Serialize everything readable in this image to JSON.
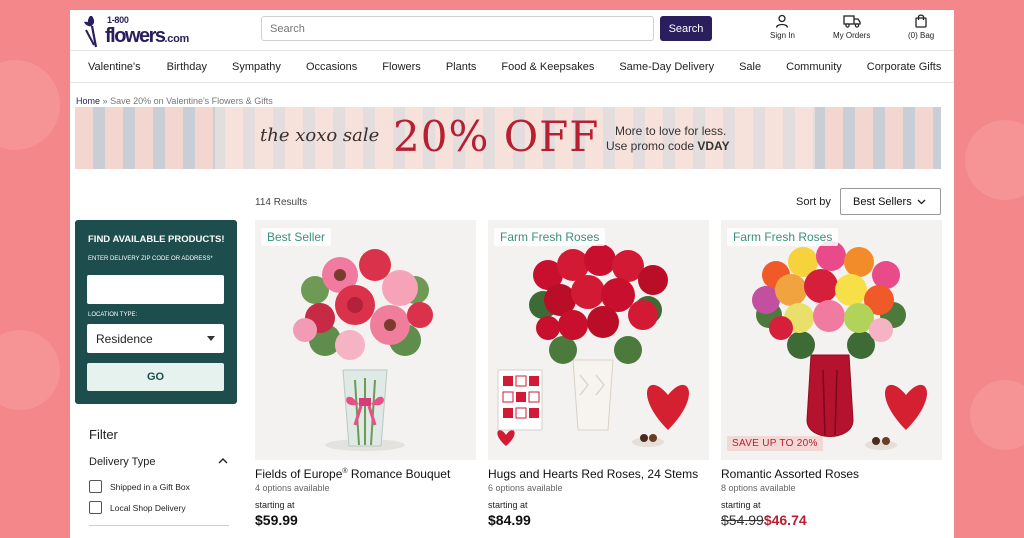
{
  "brand": {
    "logo_top": "1-800",
    "logo_main": "flowers",
    "logo_suffix": ".com"
  },
  "search": {
    "placeholder": "Search",
    "button_label": "Search"
  },
  "header_actions": [
    {
      "label": "Sign In",
      "icon": "user-icon"
    },
    {
      "label": "My Orders",
      "icon": "truck-icon"
    },
    {
      "label": "(0) Bag",
      "icon": "bag-icon"
    }
  ],
  "nav": [
    "Valentine's",
    "Birthday",
    "Sympathy",
    "Occasions",
    "Flowers",
    "Plants",
    "Food & Keepsakes",
    "Same-Day Delivery",
    "Sale",
    "Community",
    "Corporate Gifts"
  ],
  "breadcrumb": {
    "home": "Home",
    "separator": "»",
    "current": "Save 20% on Valentine's Flowers & Gifts"
  },
  "banner": {
    "script_text": "the xoxo sale",
    "headline": "20% OFF",
    "line1": "More to love for less.",
    "line2_prefix": "Use promo code ",
    "promo_code": "VDAY"
  },
  "results": {
    "count": "114 Results",
    "sort_label": "Sort by",
    "sort_value": "Best Sellers"
  },
  "finder": {
    "title": "FIND AVAILABLE PRODUCTS!",
    "zip_label": "ENTER DELIVERY ZIP CODE OR ADDRESS*",
    "zip_value": "",
    "location_label": "LOCATION TYPE:",
    "location_value": "Residence",
    "go_label": "GO"
  },
  "filter": {
    "title": "Filter",
    "group": "Delivery Type",
    "options": [
      "Shipped in a Gift Box",
      "Local Shop Delivery"
    ]
  },
  "products": [
    {
      "badge": "Best Seller",
      "name": "Fields of Europe",
      "name_mark": "®",
      "name_suffix": " Romance Bouquet",
      "options": "4 options available",
      "starting": "starting at",
      "price": "$59.99"
    },
    {
      "badge": "Farm Fresh Roses",
      "name": "Hugs and Hearts Red Roses, 24 Stems",
      "options": "6 options available",
      "starting": "starting at",
      "price": "$84.99"
    },
    {
      "badge": "Farm Fresh Roses",
      "sale_badge": "SAVE UP TO 20%",
      "name": "Romantic Assorted Roses",
      "options": "8 options available",
      "starting": "starting at",
      "old_price": "$54.99",
      "price": "$46.74"
    }
  ],
  "colors": {
    "brand": "#2a1e5c",
    "teal": "#1e4d4d",
    "sale_red": "#b52033",
    "badge_green": "#3b8f7c",
    "background": "#f4878a"
  }
}
